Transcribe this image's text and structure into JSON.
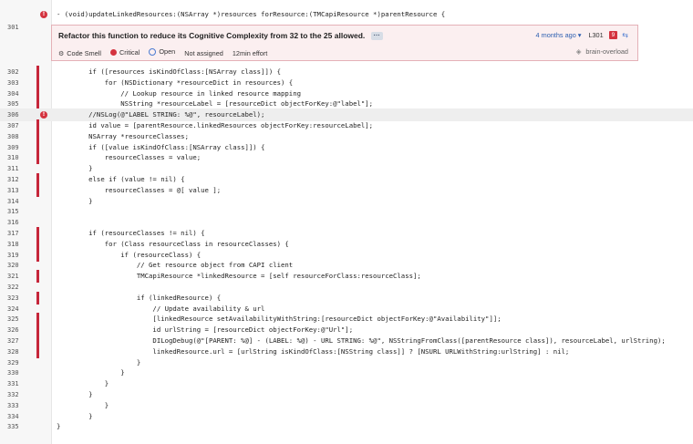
{
  "header_line": {
    "number": "301",
    "code": "- (void)updateLinkedResources:(NSArray *)resources forResource:(TMCapiResource *)parentResource {"
  },
  "issue": {
    "title": "Refactor this function to reduce its Cognitive Complexity from 32 to the 25 allowed.",
    "more_label": "···",
    "type_label": "Code Smell",
    "severity_label": "Critical",
    "status_label": "Open",
    "assignee_label": "Not assigned",
    "effort_label": "12min effort",
    "time_ago": "4 months ago ▾",
    "line_ref": "L301",
    "count": "9",
    "tag": "brain-overload",
    "colors": {
      "error": "#d4333f",
      "box_bg": "#fbeff0",
      "link": "#2d5fb0"
    },
    "icons": [
      "code-smell-icon",
      "critical-icon",
      "open-status-icon",
      "sync-icon",
      "tag-icon"
    ]
  },
  "lines": [
    {
      "n": "302",
      "marked": true,
      "code": "        if ([resources isKindOfClass:[NSArray class]]) {"
    },
    {
      "n": "303",
      "marked": true,
      "code": "            for (NSDictionary *resourceDict in resources) {"
    },
    {
      "n": "304",
      "marked": true,
      "code": "                // Lookup resource in linked resource mapping"
    },
    {
      "n": "305",
      "marked": true,
      "code": "                NSString *resourceLabel = [resourceDict objectForKey:@\"label\"];"
    },
    {
      "n": "306",
      "marked": false,
      "code": "        //NSLog(@\"LABEL STRING: %@\", resourceLabel);",
      "highlight": true,
      "issue": true
    },
    {
      "n": "307",
      "marked": true,
      "code": "        id value = [parentResource.linkedResources objectForKey:resourceLabel];"
    },
    {
      "n": "308",
      "marked": true,
      "code": "        NSArray *resourceClasses;"
    },
    {
      "n": "309",
      "marked": true,
      "code": "        if ([value isKindOfClass:[NSArray class]]) {"
    },
    {
      "n": "310",
      "marked": true,
      "code": "            resourceClasses = value;"
    },
    {
      "n": "311",
      "marked": false,
      "code": "        }"
    },
    {
      "n": "312",
      "marked": true,
      "code": "        else if (value != nil) {"
    },
    {
      "n": "313",
      "marked": true,
      "code": "            resourceClasses = @[ value ];"
    },
    {
      "n": "314",
      "marked": false,
      "code": "        }"
    },
    {
      "n": "315",
      "marked": false,
      "code": ""
    },
    {
      "n": "316",
      "marked": false,
      "code": ""
    },
    {
      "n": "317",
      "marked": true,
      "code": "        if (resourceClasses != nil) {"
    },
    {
      "n": "318",
      "marked": true,
      "code": "            for (Class resourceClass in resourceClasses) {"
    },
    {
      "n": "319",
      "marked": true,
      "code": "                if (resourceClass) {"
    },
    {
      "n": "320",
      "marked": false,
      "code": "                    // Get resource object from CAPI client"
    },
    {
      "n": "321",
      "marked": true,
      "code": "                    TMCapiResource *linkedResource = [self resourceForClass:resourceClass];"
    },
    {
      "n": "322",
      "marked": false,
      "code": ""
    },
    {
      "n": "323",
      "marked": true,
      "code": "                    if (linkedResource) {"
    },
    {
      "n": "324",
      "marked": false,
      "code": "                        // Update availability & url"
    },
    {
      "n": "325",
      "marked": true,
      "code": "                        [linkedResource setAvailabilityWithString:[resourceDict objectForKey:@\"Availability\"]];"
    },
    {
      "n": "326",
      "marked": true,
      "code": "                        id urlString = [resourceDict objectForKey:@\"Url\"];"
    },
    {
      "n": "327",
      "marked": true,
      "code": "                        DILogDebug(@\"[PARENT: %@] - (LABEL: %@) - URL STRING: %@\", NSStringFromClass([parentResource class]), resourceLabel, urlString);"
    },
    {
      "n": "328",
      "marked": true,
      "code": "                        linkedResource.url = [urlString isKindOfClass:[NSString class]] ? [NSURL URLWithString:urlString] : nil;"
    },
    {
      "n": "329",
      "marked": false,
      "code": "                    }"
    },
    {
      "n": "330",
      "marked": false,
      "code": "                }"
    },
    {
      "n": "331",
      "marked": false,
      "code": "            }"
    },
    {
      "n": "332",
      "marked": false,
      "code": "        }"
    },
    {
      "n": "333",
      "marked": false,
      "code": "            }"
    },
    {
      "n": "334",
      "marked": false,
      "code": "        }"
    },
    {
      "n": "335",
      "marked": false,
      "code": "}"
    }
  ]
}
